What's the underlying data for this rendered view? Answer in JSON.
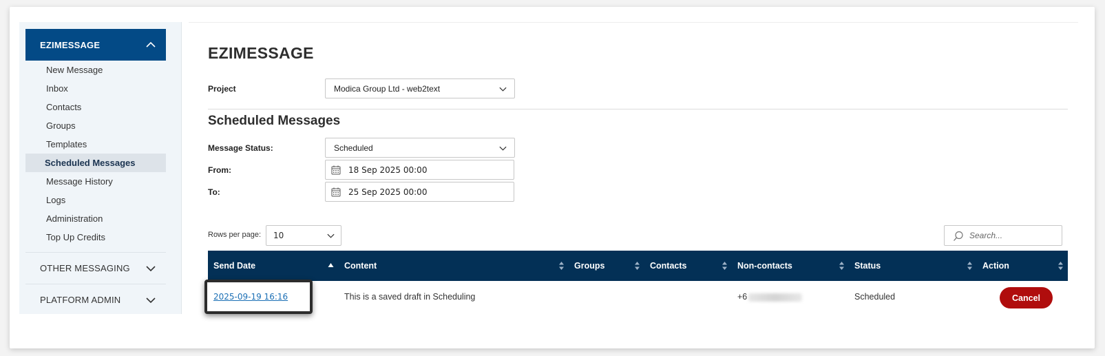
{
  "sidebar": {
    "header": "EZIMESSAGE",
    "items": [
      {
        "label": "New Message"
      },
      {
        "label": "Inbox"
      },
      {
        "label": "Contacts"
      },
      {
        "label": "Groups"
      },
      {
        "label": "Templates"
      },
      {
        "label": "Scheduled Messages",
        "active": true
      },
      {
        "label": "Message History"
      },
      {
        "label": "Logs"
      },
      {
        "label": "Administration"
      },
      {
        "label": "Top Up Credits"
      }
    ],
    "groups": [
      {
        "label": "OTHER MESSAGING"
      },
      {
        "label": "PLATFORM ADMIN"
      }
    ]
  },
  "main": {
    "title": "EZIMESSAGE",
    "project_label": "Project",
    "project_value": "Modica Group Ltd - web2text",
    "section_title": "Scheduled Messages",
    "status_label": "Message Status:",
    "status_value": "Scheduled",
    "from_label": "From:",
    "from_value": "18 Sep 2025 00:00",
    "to_label": "To:",
    "to_value": "25 Sep 2025 00:00",
    "rows_label": "Rows per page:",
    "rows_value": "10",
    "search_placeholder": "Search..."
  },
  "table": {
    "columns": [
      "Send Date",
      "Content",
      "Groups",
      "Contacts",
      "Non-contacts",
      "Status",
      "Action"
    ],
    "rows": [
      {
        "send_date": "2025-09-19 16:16",
        "content": "This is a saved draft in Scheduling",
        "groups": "",
        "contacts": "",
        "non_contacts": "+6",
        "status": "Scheduled",
        "action": "Cancel"
      }
    ]
  },
  "colors": {
    "sidebar_header": "#034a86",
    "table_header": "#033056",
    "cancel_button": "#b00d0d",
    "link": "#1b6fb5"
  }
}
